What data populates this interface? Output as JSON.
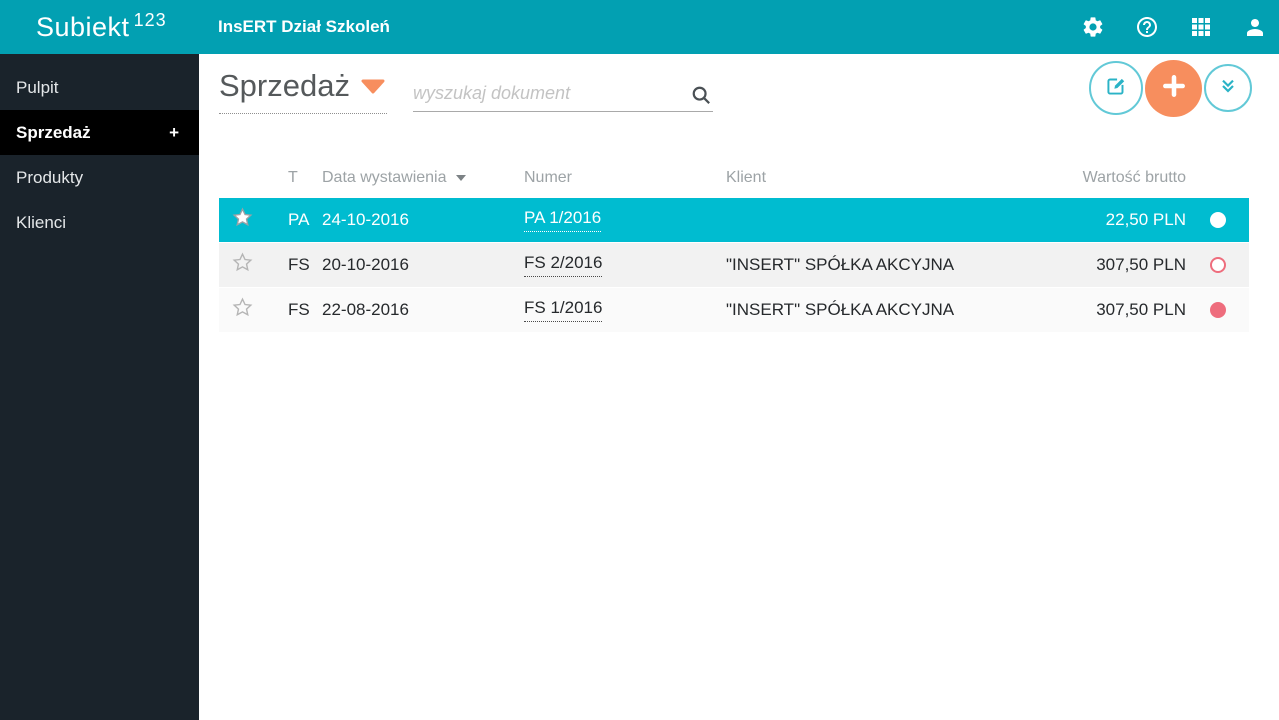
{
  "topbar": {
    "brand": "Subiekt",
    "brand_sup": "123",
    "company_title": "InsERT Dział Szkoleń",
    "icons": [
      "settings-icon",
      "help-icon",
      "apps-grid-icon",
      "user-icon"
    ]
  },
  "sidebar": {
    "items": [
      {
        "label": "Pulpit",
        "active": false
      },
      {
        "label": "Sprzedaż",
        "active": true,
        "badge": "+"
      },
      {
        "label": "Produkty",
        "active": false
      },
      {
        "label": "Klienci",
        "active": false
      }
    ]
  },
  "main": {
    "page_title": "Sprzedaż",
    "search_placeholder": "wyszukaj dokument",
    "actions": [
      "edit-document",
      "add-document",
      "collapse-list"
    ],
    "table": {
      "columns": {
        "type": "T",
        "date": "Data wystawienia",
        "number": "Numer",
        "client": "Klient",
        "gross": "Wartość brutto"
      },
      "sorted_by": "date",
      "rows": [
        {
          "row_class": "selected",
          "star": "filled",
          "type": "PA",
          "date": "24-10-2016",
          "number": "PA 1/2016",
          "client": "",
          "gross": "22,50 PLN",
          "status": "dot-white"
        },
        {
          "row_class": "zebra-a",
          "star": "outline",
          "type": "FS",
          "date": "20-10-2016",
          "number": "FS 2/2016",
          "client": "\"INSERT\" SPÓŁKA AKCYJNA",
          "gross": "307,50 PLN",
          "status": "dot-outline"
        },
        {
          "row_class": "zebra-b",
          "star": "outline",
          "type": "FS",
          "date": "22-08-2016",
          "number": "FS 1/2016",
          "client": "\"INSERT\" SPÓŁKA AKCYJNA",
          "gross": "307,50 PLN",
          "status": "dot-filled"
        }
      ]
    }
  },
  "colors": {
    "topbar": "#02a0b2",
    "selected_row": "#00bcd0",
    "sidebar": "#1a232b",
    "sidebar_active": "#000000",
    "accent_orange": "#f78e5e",
    "status_pink": "#ee6d7d",
    "zebra_light": "#f2f2f2",
    "zebra_lighter": "#fafafa"
  }
}
